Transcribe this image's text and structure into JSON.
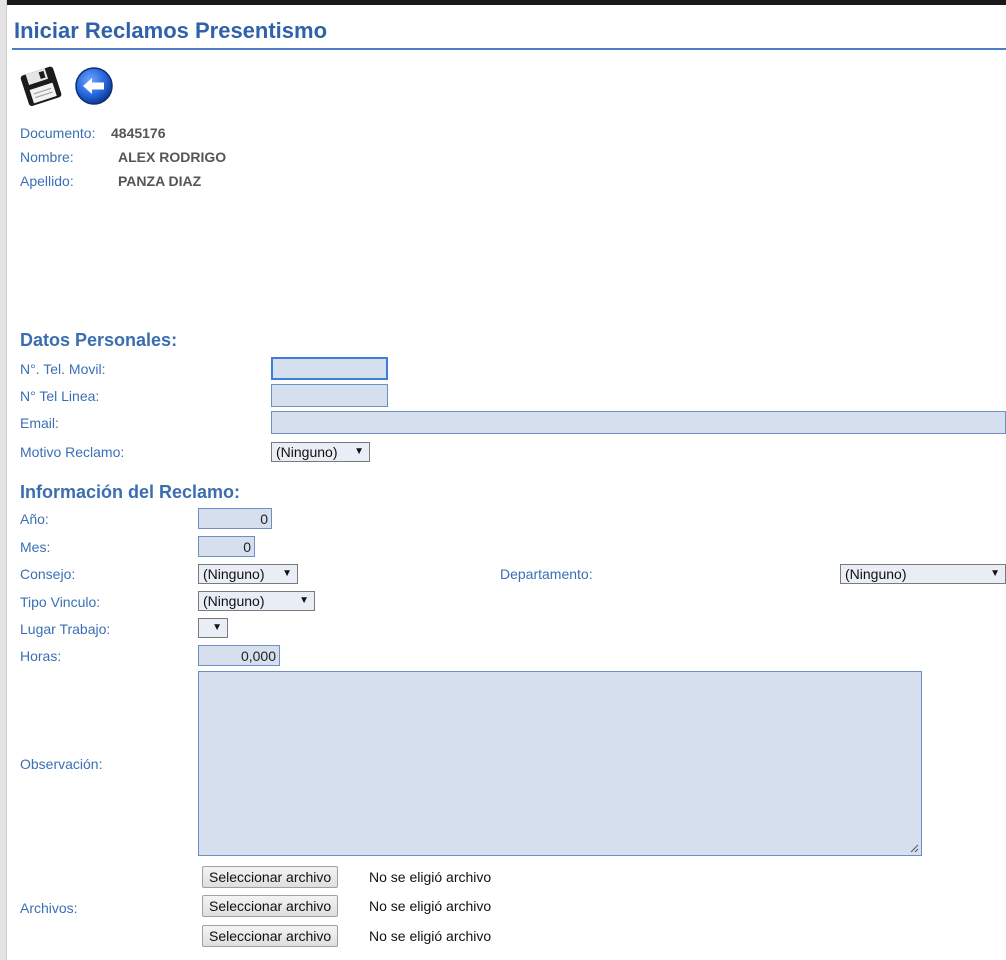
{
  "page": {
    "title": "Iniciar Reclamos Presentismo"
  },
  "toolbar": {
    "save_icon": "floppy-disk-icon",
    "back_icon": "back-arrow-icon"
  },
  "person": {
    "documento_label": "Documento:",
    "documento_value": "4845176",
    "nombre_label": "Nombre:",
    "nombre_value": "ALEX RODRIGO",
    "apellido_label": "Apellido:",
    "apellido_value": "PANZA DIAZ"
  },
  "datos_personales": {
    "heading": "Datos Personales:",
    "tel_movil_label": "N°. Tel. Movil:",
    "tel_movil_value": "",
    "tel_linea_label": "N° Tel Linea:",
    "tel_linea_value": "",
    "email_label": "Email:",
    "email_value": "",
    "motivo_label": "Motivo Reclamo:",
    "motivo_value": "(Ninguno)"
  },
  "reclamo": {
    "heading": "Información del Reclamo:",
    "anio_label": "Año:",
    "anio_value": "0",
    "mes_label": "Mes:",
    "mes_value": "0",
    "consejo_label": "Consejo:",
    "consejo_value": "(Ninguno)",
    "departamento_label": "Departamento:",
    "departamento_value": "(Ninguno)",
    "tipo_vinculo_label": "Tipo Vinculo:",
    "tipo_vinculo_value": "(Ninguno)",
    "lugar_trabajo_label": "Lugar Trabajo:",
    "lugar_trabajo_value": "",
    "horas_label": "Horas:",
    "horas_value": "0,000",
    "observacion_label": "Observación:",
    "observacion_value": "",
    "archivos_label": "Archivos:",
    "files": [
      {
        "button": "Seleccionar archivo",
        "status": "No se eligió archivo"
      },
      {
        "button": "Seleccionar archivo",
        "status": "No se eligió archivo"
      },
      {
        "button": "Seleccionar archivo",
        "status": "No se eligió archivo"
      }
    ]
  },
  "colors": {
    "accent": "#2f62a8",
    "label": "#3a6fb5",
    "field_bg": "#d6dfee"
  }
}
